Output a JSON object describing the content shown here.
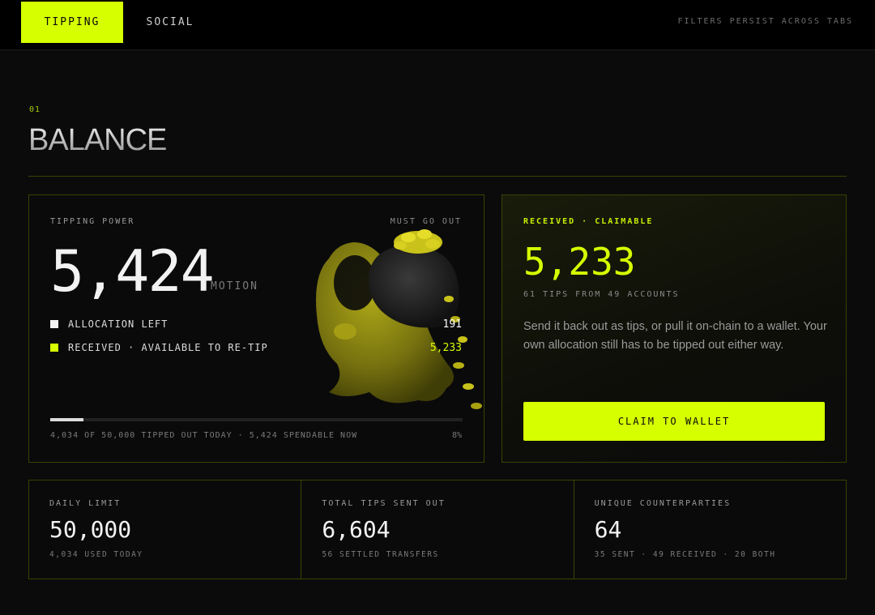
{
  "nav": {
    "tabs": [
      {
        "label": "TIPPING",
        "active": true
      },
      {
        "label": "SOCIAL",
        "active": false
      }
    ],
    "note": "FILTERS PERSIST ACROSS TABS"
  },
  "section": {
    "number": "01",
    "title": "BALANCE"
  },
  "tipping_power": {
    "label": "TIPPING POWER",
    "tag": "MUST GO OUT",
    "value": "5,424",
    "unit": "MOTION",
    "legend": [
      {
        "label": "ALLOCATION LEFT",
        "value": "191",
        "color": "#f2f2f2"
      },
      {
        "label": "RECEIVED · AVAILABLE TO RE-TIP",
        "value": "5,233",
        "color": "#d6ff00"
      }
    ],
    "progress_fraction": 0.08,
    "footer": "4,034 OF 50,000 TIPPED OUT TODAY · 5,424 SPENDABLE NOW",
    "percent": "8%",
    "mascot_icon": "money-bag-character-icon"
  },
  "received": {
    "label": "RECEIVED · CLAIMABLE",
    "value": "5,233",
    "sub": "61 TIPS FROM 49 ACCOUNTS",
    "description": "Send it back out as tips, or pull it on-chain to a wallet. Your own allocation still has to be tipped out either way.",
    "button_label": "CLAIM TO WALLET"
  },
  "stats": [
    {
      "label": "DAILY LIMIT",
      "value": "50,000",
      "sub": "4,034 USED TODAY"
    },
    {
      "label": "TOTAL TIPS SENT OUT",
      "value": "6,604",
      "sub": "56 SETTLED TRANSFERS"
    },
    {
      "label": "UNIQUE COUNTERPARTIES",
      "value": "64",
      "sub": "35 SENT · 49 RECEIVED · 20 BOTH"
    }
  ],
  "colors": {
    "accent": "#d6ff00",
    "background": "#0b0b0c",
    "border": "#3a4200"
  }
}
